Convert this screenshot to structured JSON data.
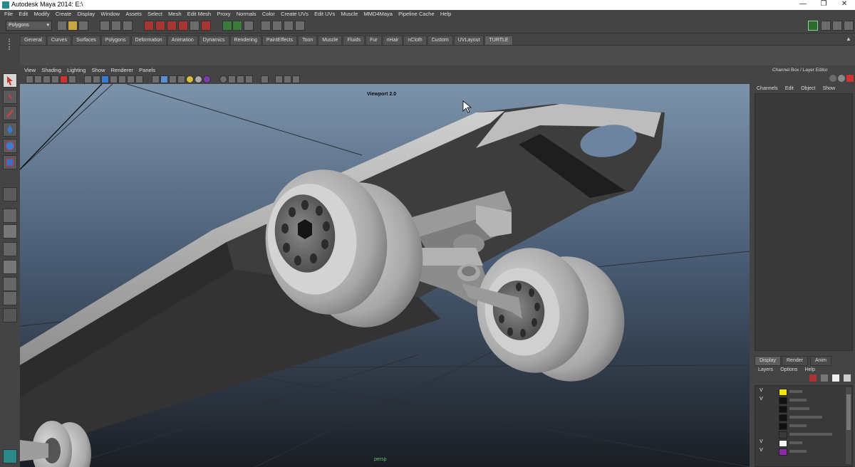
{
  "window": {
    "title": "Autodesk Maya 2014: E:\\",
    "minimize": "—",
    "maximize": "❐",
    "close": "✕"
  },
  "menubar": [
    "File",
    "Edit",
    "Modify",
    "Create",
    "Display",
    "Window",
    "Assets",
    "Select",
    "Mesh",
    "Edit Mesh",
    "Proxy",
    "Normals",
    "Color",
    "Create UVs",
    "Edit UVs",
    "Muscle",
    "MMD4Maya",
    "Pipeline Cache",
    "Help"
  ],
  "status_line": {
    "menu_set": "Polygons"
  },
  "shelf_tabs": [
    "General",
    "Curves",
    "Surfaces",
    "Polygons",
    "Deformation",
    "Animation",
    "Dynamics",
    "Rendering",
    "PaintEffects",
    "Toon",
    "Muscle",
    "Fluids",
    "Fur",
    "nHair",
    "nCloth",
    "Custom",
    "UVLayout",
    "TURTLE"
  ],
  "shelf_active": "TURTLE",
  "viewport": {
    "menu": [
      "View",
      "Shading",
      "Lighting",
      "Show",
      "Renderer",
      "Panels"
    ],
    "renderer_label": "Viewport 2.0",
    "camera_label": "persp"
  },
  "channel_box": {
    "title": "Channel Box / Layer Editor",
    "menu": [
      "Channels",
      "Edit",
      "Object",
      "Show"
    ]
  },
  "layer_editor": {
    "tabs": [
      "Display",
      "Render",
      "Anim"
    ],
    "active_tab": "Display",
    "menu": [
      "Layers",
      "Options",
      "Help"
    ],
    "layers": [
      {
        "visible": "V",
        "color": "#f2e600"
      },
      {
        "visible": "V",
        "color": "#111111"
      },
      {
        "visible": "",
        "color": "#111111"
      },
      {
        "visible": "",
        "color": "#111111"
      },
      {
        "visible": "",
        "color": "#111111"
      },
      {
        "visible": "",
        "color": "#3a3a3a"
      },
      {
        "visible": "V",
        "color": "#f4f4f4"
      },
      {
        "visible": "V",
        "color": "#8a2aa8"
      }
    ]
  },
  "colors": {
    "accent": "#3fa0a0",
    "selected_tool": "#d7d7d7"
  }
}
